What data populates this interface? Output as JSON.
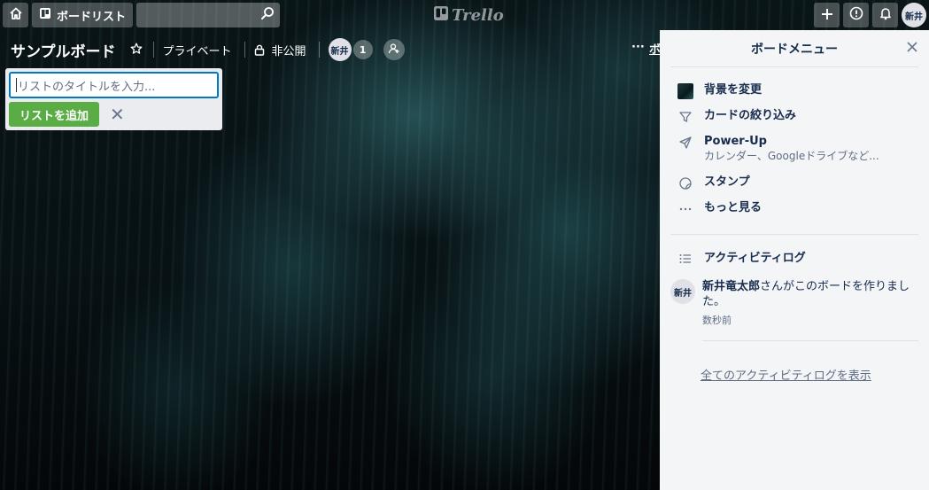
{
  "header": {
    "boards_label": "ボードリスト",
    "logo_text": "Trello",
    "avatar_initials": "新井"
  },
  "board": {
    "title": "サンプルボード",
    "visibility_label": "プライベート",
    "permission_label": "非公開",
    "member_initials": "新井",
    "member_count": "1",
    "more_label": "···",
    "show_menu_label": "ボ"
  },
  "composer": {
    "placeholder": "リストのタイトルを入力...",
    "add_label": "リストを追加",
    "cancel_label": "✕"
  },
  "menu": {
    "title": "ボードメニュー",
    "items": [
      {
        "label": "背景を変更",
        "icon": "background-thumbnail"
      },
      {
        "label": "カードの絞り込み",
        "icon": "filter-icon"
      },
      {
        "label": "Power-Up",
        "sub": "カレンダー、Googleドライブなど...",
        "icon": "rocket-icon"
      },
      {
        "label": "スタンプ",
        "icon": "sticker-icon"
      },
      {
        "label": "もっと見る",
        "icon": "more-icon"
      }
    ],
    "activity": {
      "title": "アクティビティログ",
      "entry": {
        "initials": "新井",
        "user": "新井竜太郎",
        "text": "さんがこのボードを作りました。",
        "time": "数秒前"
      },
      "view_all": "全てのアクティビティログを表示"
    }
  },
  "colors": {
    "accent_blue": "#0079bf",
    "add_green": "#5aac44",
    "menu_bg": "#f4f5f7"
  }
}
